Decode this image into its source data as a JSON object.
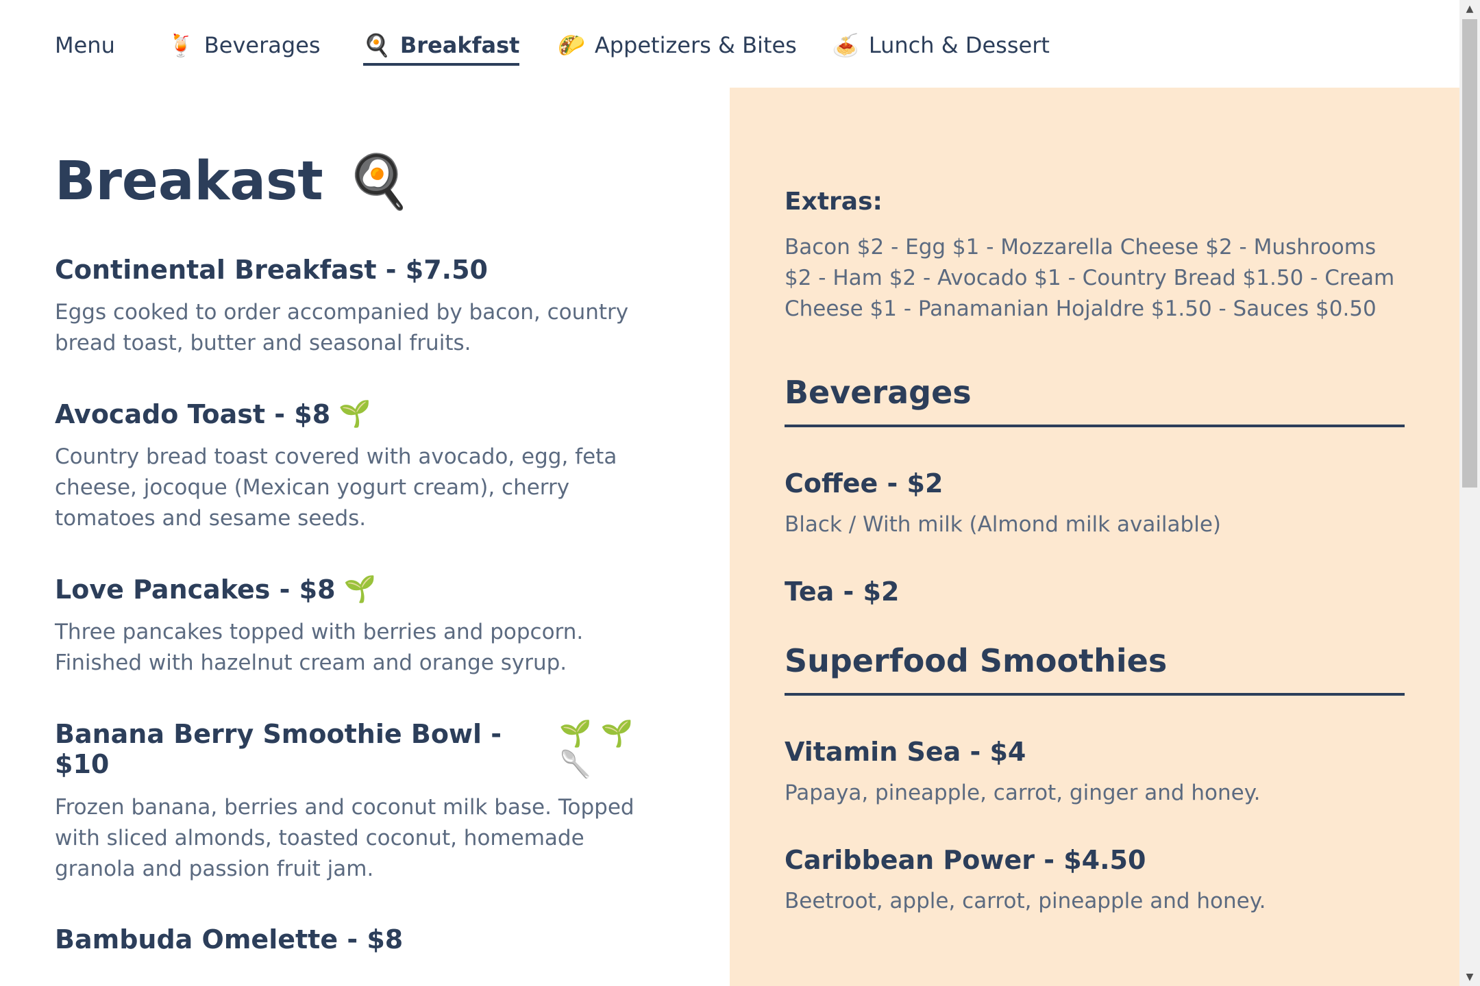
{
  "nav": {
    "items": [
      {
        "label": "Menu",
        "emoji": ""
      },
      {
        "label": "Beverages",
        "emoji": "🍹"
      },
      {
        "label": "Breakfast",
        "emoji": "🍳"
      },
      {
        "label": "Appetizers & Bites",
        "emoji": "🌮"
      },
      {
        "label": "Lunch & Dessert",
        "emoji": "🍝"
      }
    ],
    "active": "Breakfast"
  },
  "breakfast": {
    "title": "Breakast",
    "title_emoji": "🍳",
    "items": [
      {
        "title": "Continental Breakfast - $7.50",
        "tags": "",
        "description": "Eggs cooked to order accompanied by bacon, country bread toast, butter and seasonal fruits."
      },
      {
        "title": "Avocado Toast - $8",
        "tags": "🌱",
        "description": "Country bread toast covered with avocado, egg, feta cheese, jocoque (Mexican yogurt cream), cherry tomatoes and sesame seeds."
      },
      {
        "title": "Love Pancakes - $8",
        "tags": "🌱",
        "description": "Three pancakes topped with berries and popcorn. Finished with hazelnut cream and orange syrup."
      },
      {
        "title": "Banana Berry Smoothie Bowl - $10",
        "tags": "🌱 🌱 🥄",
        "description": "Frozen banana, berries and coconut milk base. Topped with sliced almonds, toasted coconut, homemade granola and passion fruit jam."
      },
      {
        "title": "Bambuda Omelette - $8",
        "tags": "",
        "description": ""
      }
    ]
  },
  "panel": {
    "extras_label": "Extras:",
    "extras_text": "Bacon $2 - Egg $1 - Mozzarella Cheese $2 - Mushrooms $2 - Ham $2 - Avocado $1 - Country Bread $1.50 - Cream Cheese $1 - Panamanian Hojaldre $1.50 - Sauces $0.50",
    "beverages": {
      "title": "Beverages",
      "items": [
        {
          "title": "Coffee - $2",
          "description": "Black / With milk (Almond milk available)"
        },
        {
          "title": "Tea - $2",
          "description": ""
        }
      ]
    },
    "smoothies": {
      "title": "Superfood Smoothies",
      "items": [
        {
          "title": "Vitamin Sea - $4",
          "description": "Papaya, pineapple, carrot, ginger and honey."
        },
        {
          "title": "Caribbean Power - $4.50",
          "description": "Beetroot, apple, carrot, pineapple and honey."
        }
      ]
    }
  },
  "colors": {
    "text_primary": "#2c3e5a",
    "text_secondary": "#5b6a80",
    "panel_bg": "#fde8d0"
  }
}
